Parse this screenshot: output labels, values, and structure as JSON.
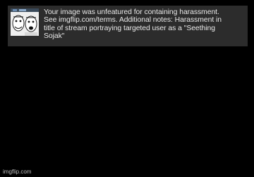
{
  "notice": {
    "thumbnail_icon": "soyjak-meme-thumbnail",
    "message": "Your image was unfeatured for containing harassment.\nSee imgflip.com/terms. Additional notes: Harassment in\ntitle of stream portraying targeted user as a \"Seething\nSojak\""
  },
  "watermark": "imgflip.com",
  "colors": {
    "background": "#000000",
    "notice_background": "#2c2c2c",
    "notice_text": "#e9e9e9"
  }
}
